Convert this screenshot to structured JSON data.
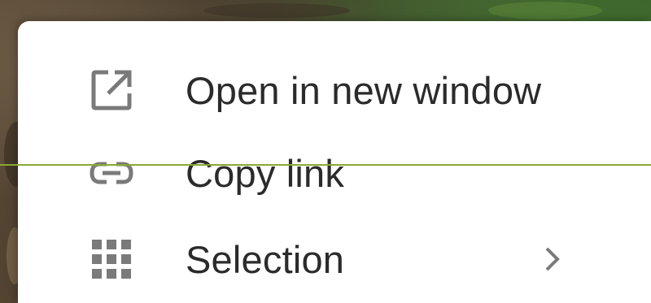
{
  "menu": {
    "items": [
      {
        "label": "Open in new window",
        "icon": "open-in-new-window-icon"
      },
      {
        "label": "Copy link",
        "icon": "link-icon"
      },
      {
        "label": "Selection",
        "icon": "grid-icon",
        "has_submenu": true,
        "submenu_icon": "chevron-right-icon"
      }
    ]
  },
  "colors": {
    "menu_background": "#ffffff",
    "label_text": "#2b2b2b",
    "icon": "#7a7a7a",
    "guide_line": "#8aa832"
  }
}
